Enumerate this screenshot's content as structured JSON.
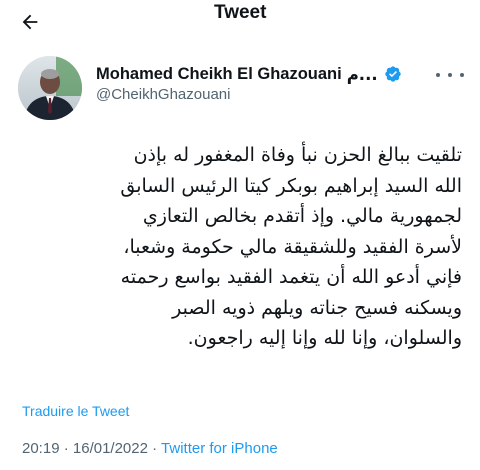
{
  "header": {
    "title": "Tweet",
    "back_icon": "arrow-left-icon"
  },
  "author": {
    "name": "Mohamed Cheikh El Ghazouani",
    "name_suffix": "م...",
    "handle": "@CheikhGhazouani",
    "verified_icon": "verified-badge-icon",
    "more_icon": "more-horizontal-icon"
  },
  "tweet": {
    "lines": [
      "تلقيت ببالغ الحزن نبأ وفاة المغفور له بإذن",
      "الله السيد إبراهيم بوبكر كيتا الرئيس السابق",
      "لجمهورية مالي. وإذ أتقدم بخالص التعازي",
      "لأسرة الفقيد وللشقيقة مالي حكومة وشعبا،",
      "فإني أدعو الله أن يتغمد الفقيد بواسع رحمته",
      "ويسكنه فسيح جناته ويلهم ذويه الصبر",
      "والسلوان، وإنا لله وإنا إليه راجعون."
    ],
    "translate_label": "Traduire le Tweet",
    "time": "20:19",
    "separator": " · ",
    "date": "16/01/2022",
    "separator2": " · ",
    "source": "Twitter for iPhone"
  },
  "colors": {
    "accent": "#1d9bf0",
    "text": "#0f1419",
    "secondary": "#536471"
  }
}
